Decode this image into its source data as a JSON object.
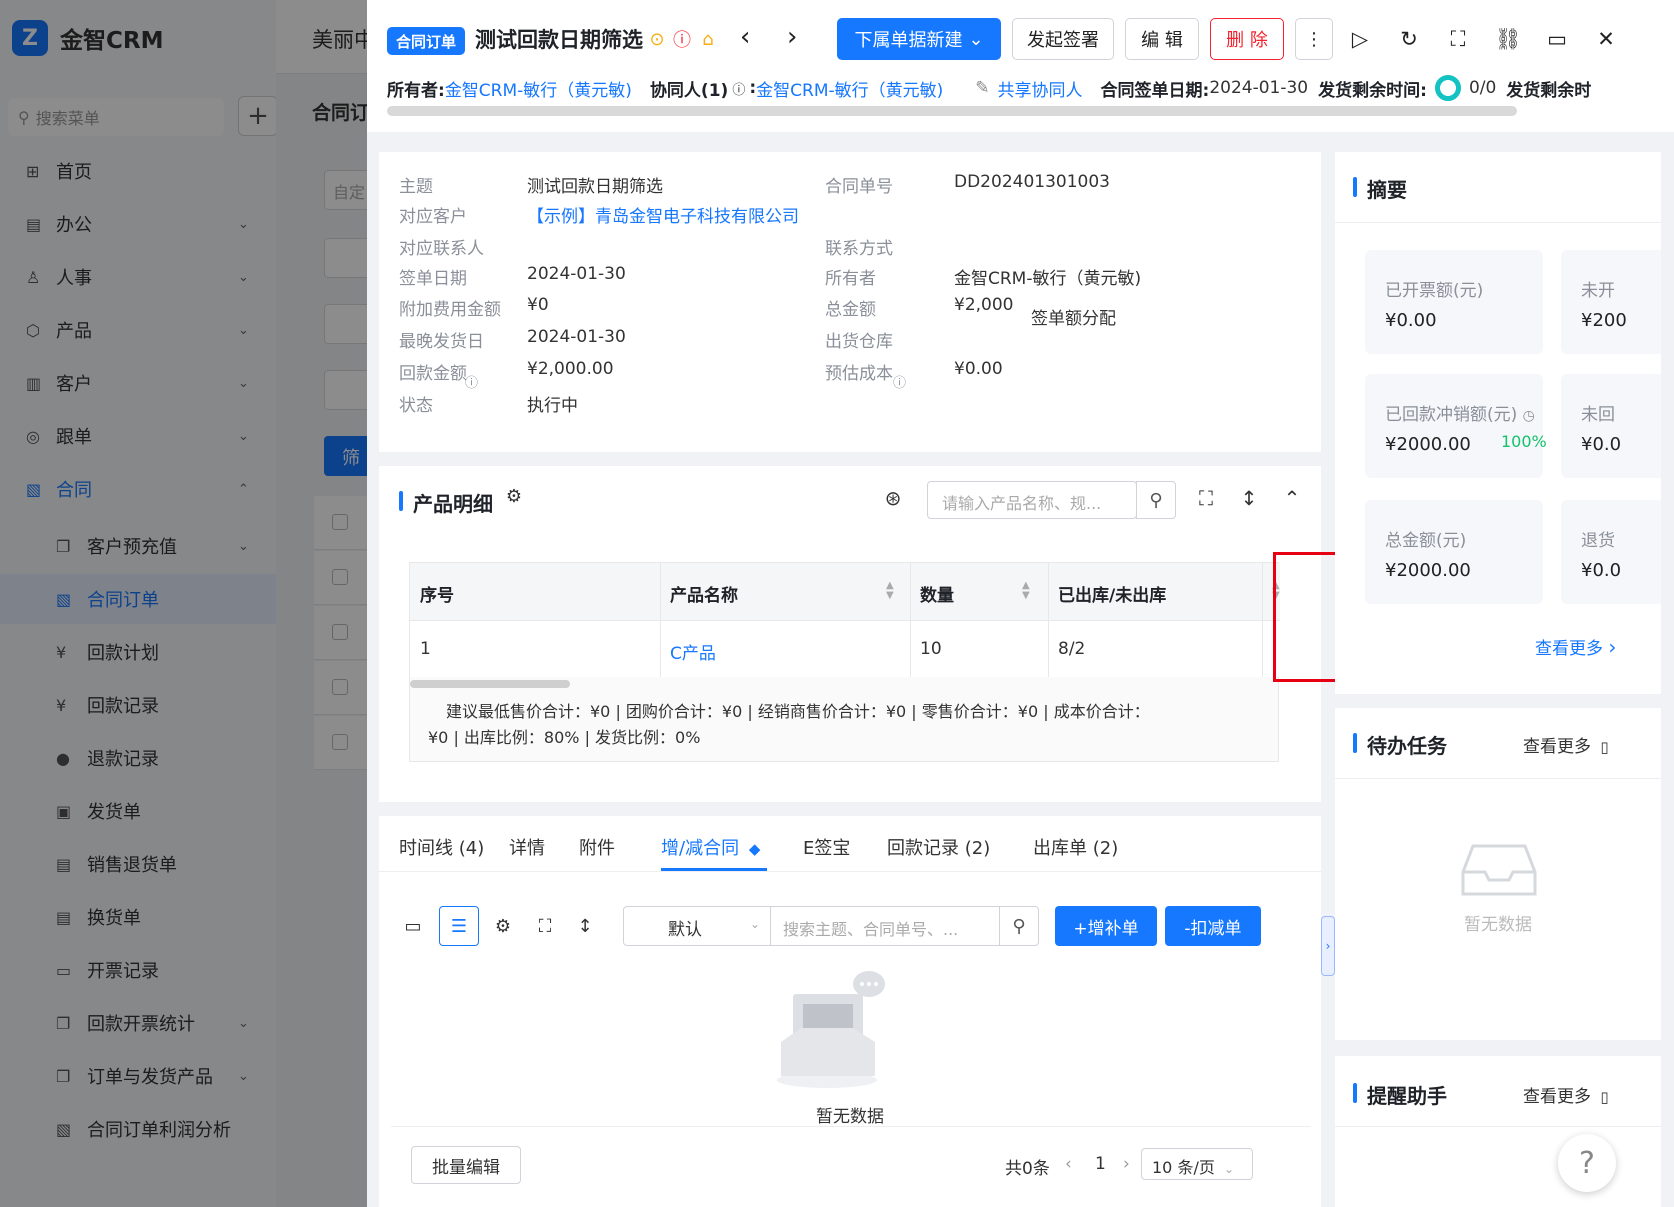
{
  "app": {
    "logo_text": "金智CRM",
    "search_placeholder": "搜索菜单",
    "bg_tab_title": "美丽中",
    "bg_subtitle": "合同订",
    "bg_filter_placeholder": "自定",
    "bg_filter_btn": "筛"
  },
  "sidebar": {
    "items": [
      {
        "icon": "⊞",
        "label": "首页",
        "arrow": ""
      },
      {
        "icon": "▤",
        "label": "办公",
        "arrow": "⌄"
      },
      {
        "icon": "♙",
        "label": "人事",
        "arrow": "⌄"
      },
      {
        "icon": "⬡",
        "label": "产品",
        "arrow": "⌄"
      },
      {
        "icon": "▥",
        "label": "客户",
        "arrow": "⌄"
      },
      {
        "icon": "◎",
        "label": "跟单",
        "arrow": "⌄"
      },
      {
        "icon": "▧",
        "label": "合同",
        "arrow": "⌃"
      },
      {
        "icon": "❐",
        "label": "客户预充值",
        "arrow": "⌄"
      },
      {
        "icon": "▧",
        "label": "合同订单",
        "arrow": ""
      },
      {
        "icon": "¥",
        "label": "回款计划",
        "arrow": ""
      },
      {
        "icon": "¥",
        "label": "回款记录",
        "arrow": ""
      },
      {
        "icon": "●",
        "label": "退款记录",
        "arrow": ""
      },
      {
        "icon": "▣",
        "label": "发货单",
        "arrow": ""
      },
      {
        "icon": "▤",
        "label": "销售退货单",
        "arrow": ""
      },
      {
        "icon": "▤",
        "label": "换货单",
        "arrow": ""
      },
      {
        "icon": "▭",
        "label": "开票记录",
        "arrow": ""
      },
      {
        "icon": "❐",
        "label": "回款开票统计",
        "arrow": "⌄"
      },
      {
        "icon": "❐",
        "label": "订单与发货产品",
        "arrow": "⌄"
      },
      {
        "icon": "▧",
        "label": "合同订单利润分析",
        "arrow": ""
      }
    ]
  },
  "drawer": {
    "type_badge": "合同订单",
    "title": "测试回款日期筛选",
    "new_btn": "下属单据新建",
    "sign_btn": "发起签署",
    "edit_btn": "编 辑",
    "delete_btn": "删 除",
    "meta": {
      "owner_label": "所有者:",
      "owner_value": "金智CRM-敏行（黄元敏)",
      "collab_label": "协同人(1)",
      "collab_value": "金智CRM-敏行（黄元敏)",
      "share_label": "共享协同人",
      "sign_date_label": "合同签单日期:",
      "sign_date_value": "2024-01-30",
      "ship_remain_label": "发货剩余时间:",
      "ship_count": "0/0",
      "ship_remain_label2": "发货剩余时"
    }
  },
  "info": {
    "fields": [
      {
        "label": "主题",
        "value": "测试回款日期筛选"
      },
      {
        "label": "对应客户",
        "value": "【示例】青岛金智电子科技有限公司"
      },
      {
        "label": "对应联系人",
        "value": ""
      },
      {
        "label": "签单日期",
        "value": "2024-01-30"
      },
      {
        "label": "附加费用金额",
        "value": "¥0"
      },
      {
        "label": "最晚发货日",
        "value": "2024-01-30"
      },
      {
        "label": "回款金额",
        "value": "¥2,000.00"
      },
      {
        "label": "状态",
        "value": "执行中"
      }
    ],
    "fields_right": [
      {
        "label": "合同单号",
        "value": "DD202401301003"
      },
      {
        "label": "联系方式",
        "value": ""
      },
      {
        "label": "所有者",
        "value": "金智CRM-敏行（黄元敏)"
      },
      {
        "label": "总金额",
        "value": "¥2,000"
      },
      {
        "label": "出货仓库",
        "value": ""
      },
      {
        "label": "预估成本",
        "value": "¥0.00"
      }
    ],
    "alloc_link": "签单额分配"
  },
  "products": {
    "title": "产品明细",
    "search_placeholder": "请输入产品名称、规...",
    "columns": [
      "序号",
      "产品名称",
      "数量",
      "已出库/未出库"
    ],
    "rows": [
      {
        "seq": "1",
        "name": "C产品",
        "qty": "10",
        "stock": "8/2"
      }
    ],
    "summary_line1": "建议最低售价合计：¥0 |   团购价合计：¥0 |   经销商售价合计：¥0 |   零售价合计：¥0 |   成本价合计：",
    "summary_line2": "¥0 |   出库比例：80% |   发货比例：0%"
  },
  "tabs": {
    "items": [
      "时间线 (4)",
      "详情",
      "附件",
      "增/减合同",
      "E签宝",
      "回款记录 (2)",
      "出库单 (2)"
    ],
    "active_index": 3,
    "select_default": "默认",
    "search_placeholder": "搜索主题、合同单号、...",
    "add_btn": "+增补单",
    "reduce_btn": "-扣减单",
    "empty_text": "暂无数据",
    "batch_edit": "批量编辑",
    "total": "共0条",
    "page": "1",
    "page_size": "10 条/页"
  },
  "summary": {
    "title": "摘要",
    "stats": [
      {
        "label": "已开票额(元)",
        "value": "¥0.00"
      },
      {
        "label": "未开",
        "value": "¥200"
      },
      {
        "label": "已回款冲销额(元)",
        "value": "¥2000.00"
      },
      {
        "label": "未回",
        "value": "¥0.0"
      },
      {
        "label": "总金额(元)",
        "value": "¥2000.00"
      },
      {
        "label": "退货",
        "value": "¥0.0"
      }
    ],
    "collect_pct": "100%",
    "more": "查看更多"
  },
  "todo": {
    "title": "待办任务",
    "more": "查看更多",
    "empty": "暂无数据"
  },
  "reminder": {
    "title": "提醒助手",
    "more": "查看更多"
  },
  "colors": {
    "accent": "#1677ff",
    "danger": "#f5222d",
    "highlight": "#e60012",
    "success": "#13c26b"
  }
}
